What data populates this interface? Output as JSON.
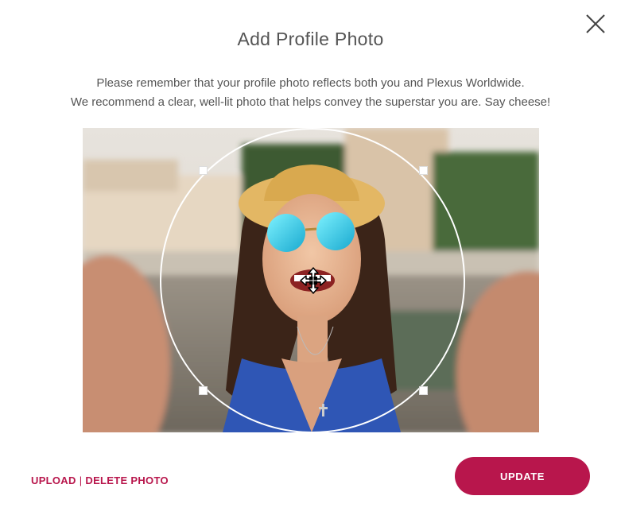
{
  "dialog": {
    "title": "Add Profile Photo",
    "description_line1": "Please remember that your profile photo reflects both you and Plexus Worldwide.",
    "description_line2": "We recommend a clear, well-lit photo that helps convey the superstar you are. Say cheese!",
    "close_icon": "close-icon"
  },
  "actions": {
    "upload_label": "UPLOAD",
    "separator": "|",
    "delete_label": "DELETE PHOTO",
    "update_label": "UPDATE"
  },
  "colors": {
    "accent": "#b8164c",
    "title_text": "#555555"
  },
  "icons": {
    "move": "move-arrows-icon",
    "close": "close-icon"
  }
}
